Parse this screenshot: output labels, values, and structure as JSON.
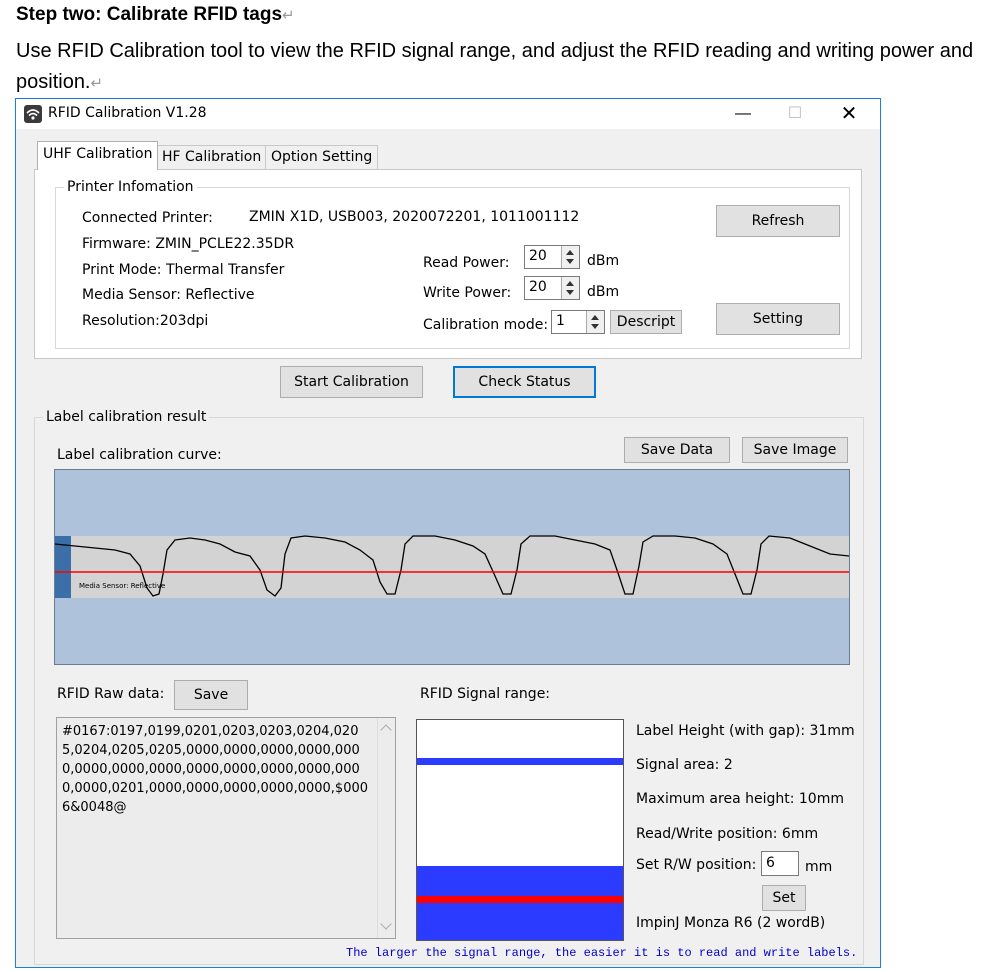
{
  "doc": {
    "heading": "Step two: Calibrate RFID tags",
    "paragraph": "Use RFID Calibration tool to view the RFID signal range, and adjust the RFID reading and writing power and position."
  },
  "window": {
    "title": "RFID Calibration V1.28",
    "minimize": "—",
    "maximize": "☐",
    "close": "✕"
  },
  "tabs": [
    "UHF Calibration",
    "HF Calibration",
    "Option Setting"
  ],
  "printer_info": {
    "legend": "Printer Infomation",
    "connected_label": "Connected Printer:",
    "connected_value": "ZMIN X1D, USB003, 2020072201, 1011001112",
    "firmware": "Firmware: ZMIN_PCLE22.35DR",
    "print_mode": "Print Mode: Thermal Transfer",
    "media_sensor": "Media Sensor: Reflective",
    "resolution": "Resolution:203dpi",
    "read_power_label": "Read Power:",
    "read_power_value": "20",
    "read_power_unit": "dBm",
    "write_power_label": "Write Power:",
    "write_power_value": "20",
    "write_power_unit": "dBm",
    "calibration_mode_label": "Calibration mode:",
    "calibration_mode_value": "1",
    "descript_button": "Descript",
    "refresh_button": "Refresh",
    "setting_button": "Setting"
  },
  "actions": {
    "start_calibration": "Start Calibration",
    "check_status": "Check Status"
  },
  "result": {
    "legend": "Label calibration result",
    "curve_label": "Label calibration curve:",
    "save_data": "Save Data",
    "save_image": "Save Image",
    "curve_annotation": "Media Sensor: Reflective",
    "raw_label": "RFID Raw data:",
    "raw_save": "Save",
    "raw_data": "#0167:0197,0199,0201,0203,0203,0204,0205,0204,0205,0205,0000,0000,0000,0000,0000,0000,0000,0000,0000,0000,0000,0000,0000,0000,0201,0000,0000,0000,0000,0000,$0006&0048@",
    "signal_label": "RFID Signal range:",
    "label_height": "Label Height (with gap): 31mm",
    "signal_area": "Signal area: 2",
    "max_area_height": "Maximum area height: 10mm",
    "rw_position": "Read/Write position: 6mm",
    "set_rw_label": "Set R/W position:",
    "set_rw_value": "6",
    "set_rw_unit": "mm",
    "set_button": "Set",
    "chip": "ImpinJ Monza R6 (2 wordB)",
    "footnote": "The larger the signal range, the easier it is to read and write labels."
  },
  "colors": {
    "curve_bg": "#aec2dc",
    "curve_band": "#d3d3d3",
    "threshold_line": "#ff0000",
    "signal_blue": "#2b3bff",
    "signal_red": "#ff0000",
    "footnote": "#0000cc"
  }
}
